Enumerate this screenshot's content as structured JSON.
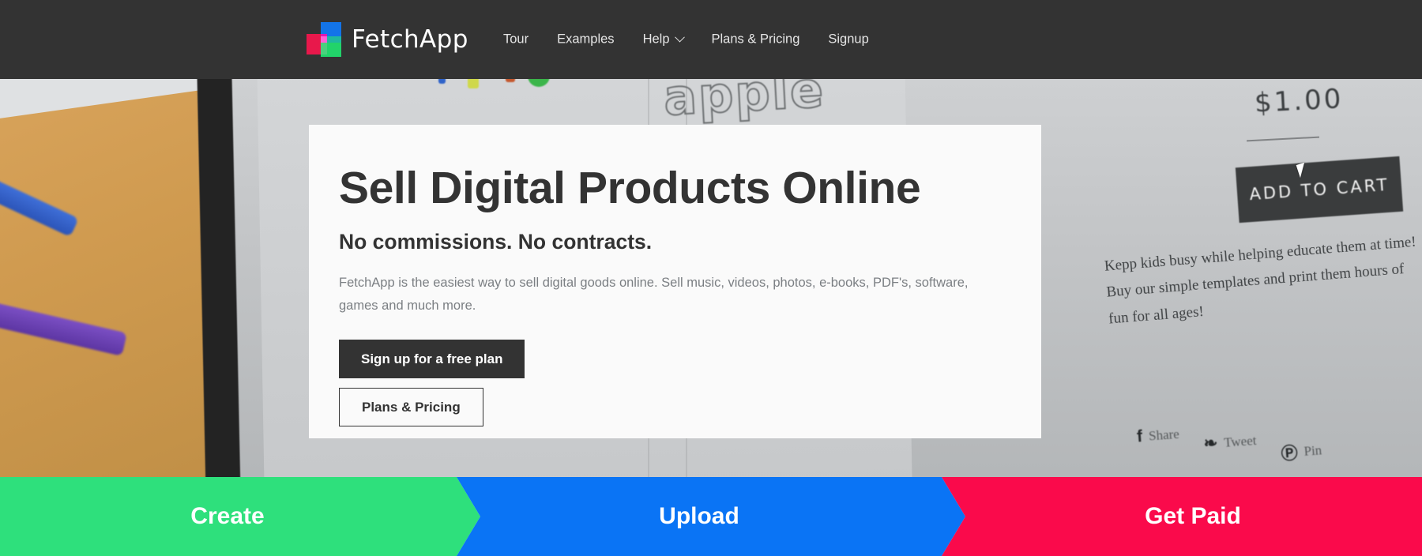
{
  "header": {
    "brand_name": "FetchApp",
    "logo_icon": "fetchapp-squares-logo",
    "nav": [
      {
        "label": "Tour",
        "has_dropdown": false
      },
      {
        "label": "Examples",
        "has_dropdown": false
      },
      {
        "label": "Help",
        "has_dropdown": true
      },
      {
        "label": "Plans & Pricing",
        "has_dropdown": false
      },
      {
        "label": "Signup",
        "has_dropdown": false
      }
    ],
    "bg_color": "#333333"
  },
  "hero": {
    "heading": "Sell Digital Products Online",
    "subheading": "No commissions. No contracts.",
    "body": "FetchApp is the easiest way to sell digital goods online. Sell music, videos, photos, e-books, PDF's, software, games and much more.",
    "primary_button": "Sign up for a free plan",
    "secondary_button": "Plans & Pricing",
    "card_bg": "#fafafa",
    "text_color": "#333333"
  },
  "background_photo": {
    "price": "$1.00",
    "add_to_cart": "ADD TO CART",
    "product_description": "Kepp kids busy while helping educate them at time! Buy our simple templates and print them hours of fun for all ages!",
    "worksheet_word": "apple",
    "social": [
      {
        "icon": "facebook-icon",
        "glyph": "f",
        "label": "Share"
      },
      {
        "icon": "twitter-icon",
        "glyph": "❧",
        "label": "Tweet"
      },
      {
        "icon": "pinterest-icon",
        "glyph": "Ⓟ",
        "label": "Pin"
      }
    ]
  },
  "steps": {
    "items": [
      {
        "label": "Create",
        "color": "#2ee07c"
      },
      {
        "label": "Upload",
        "color": "#0a74f5"
      },
      {
        "label": "Get Paid",
        "color": "#fa0a4b"
      }
    ]
  }
}
